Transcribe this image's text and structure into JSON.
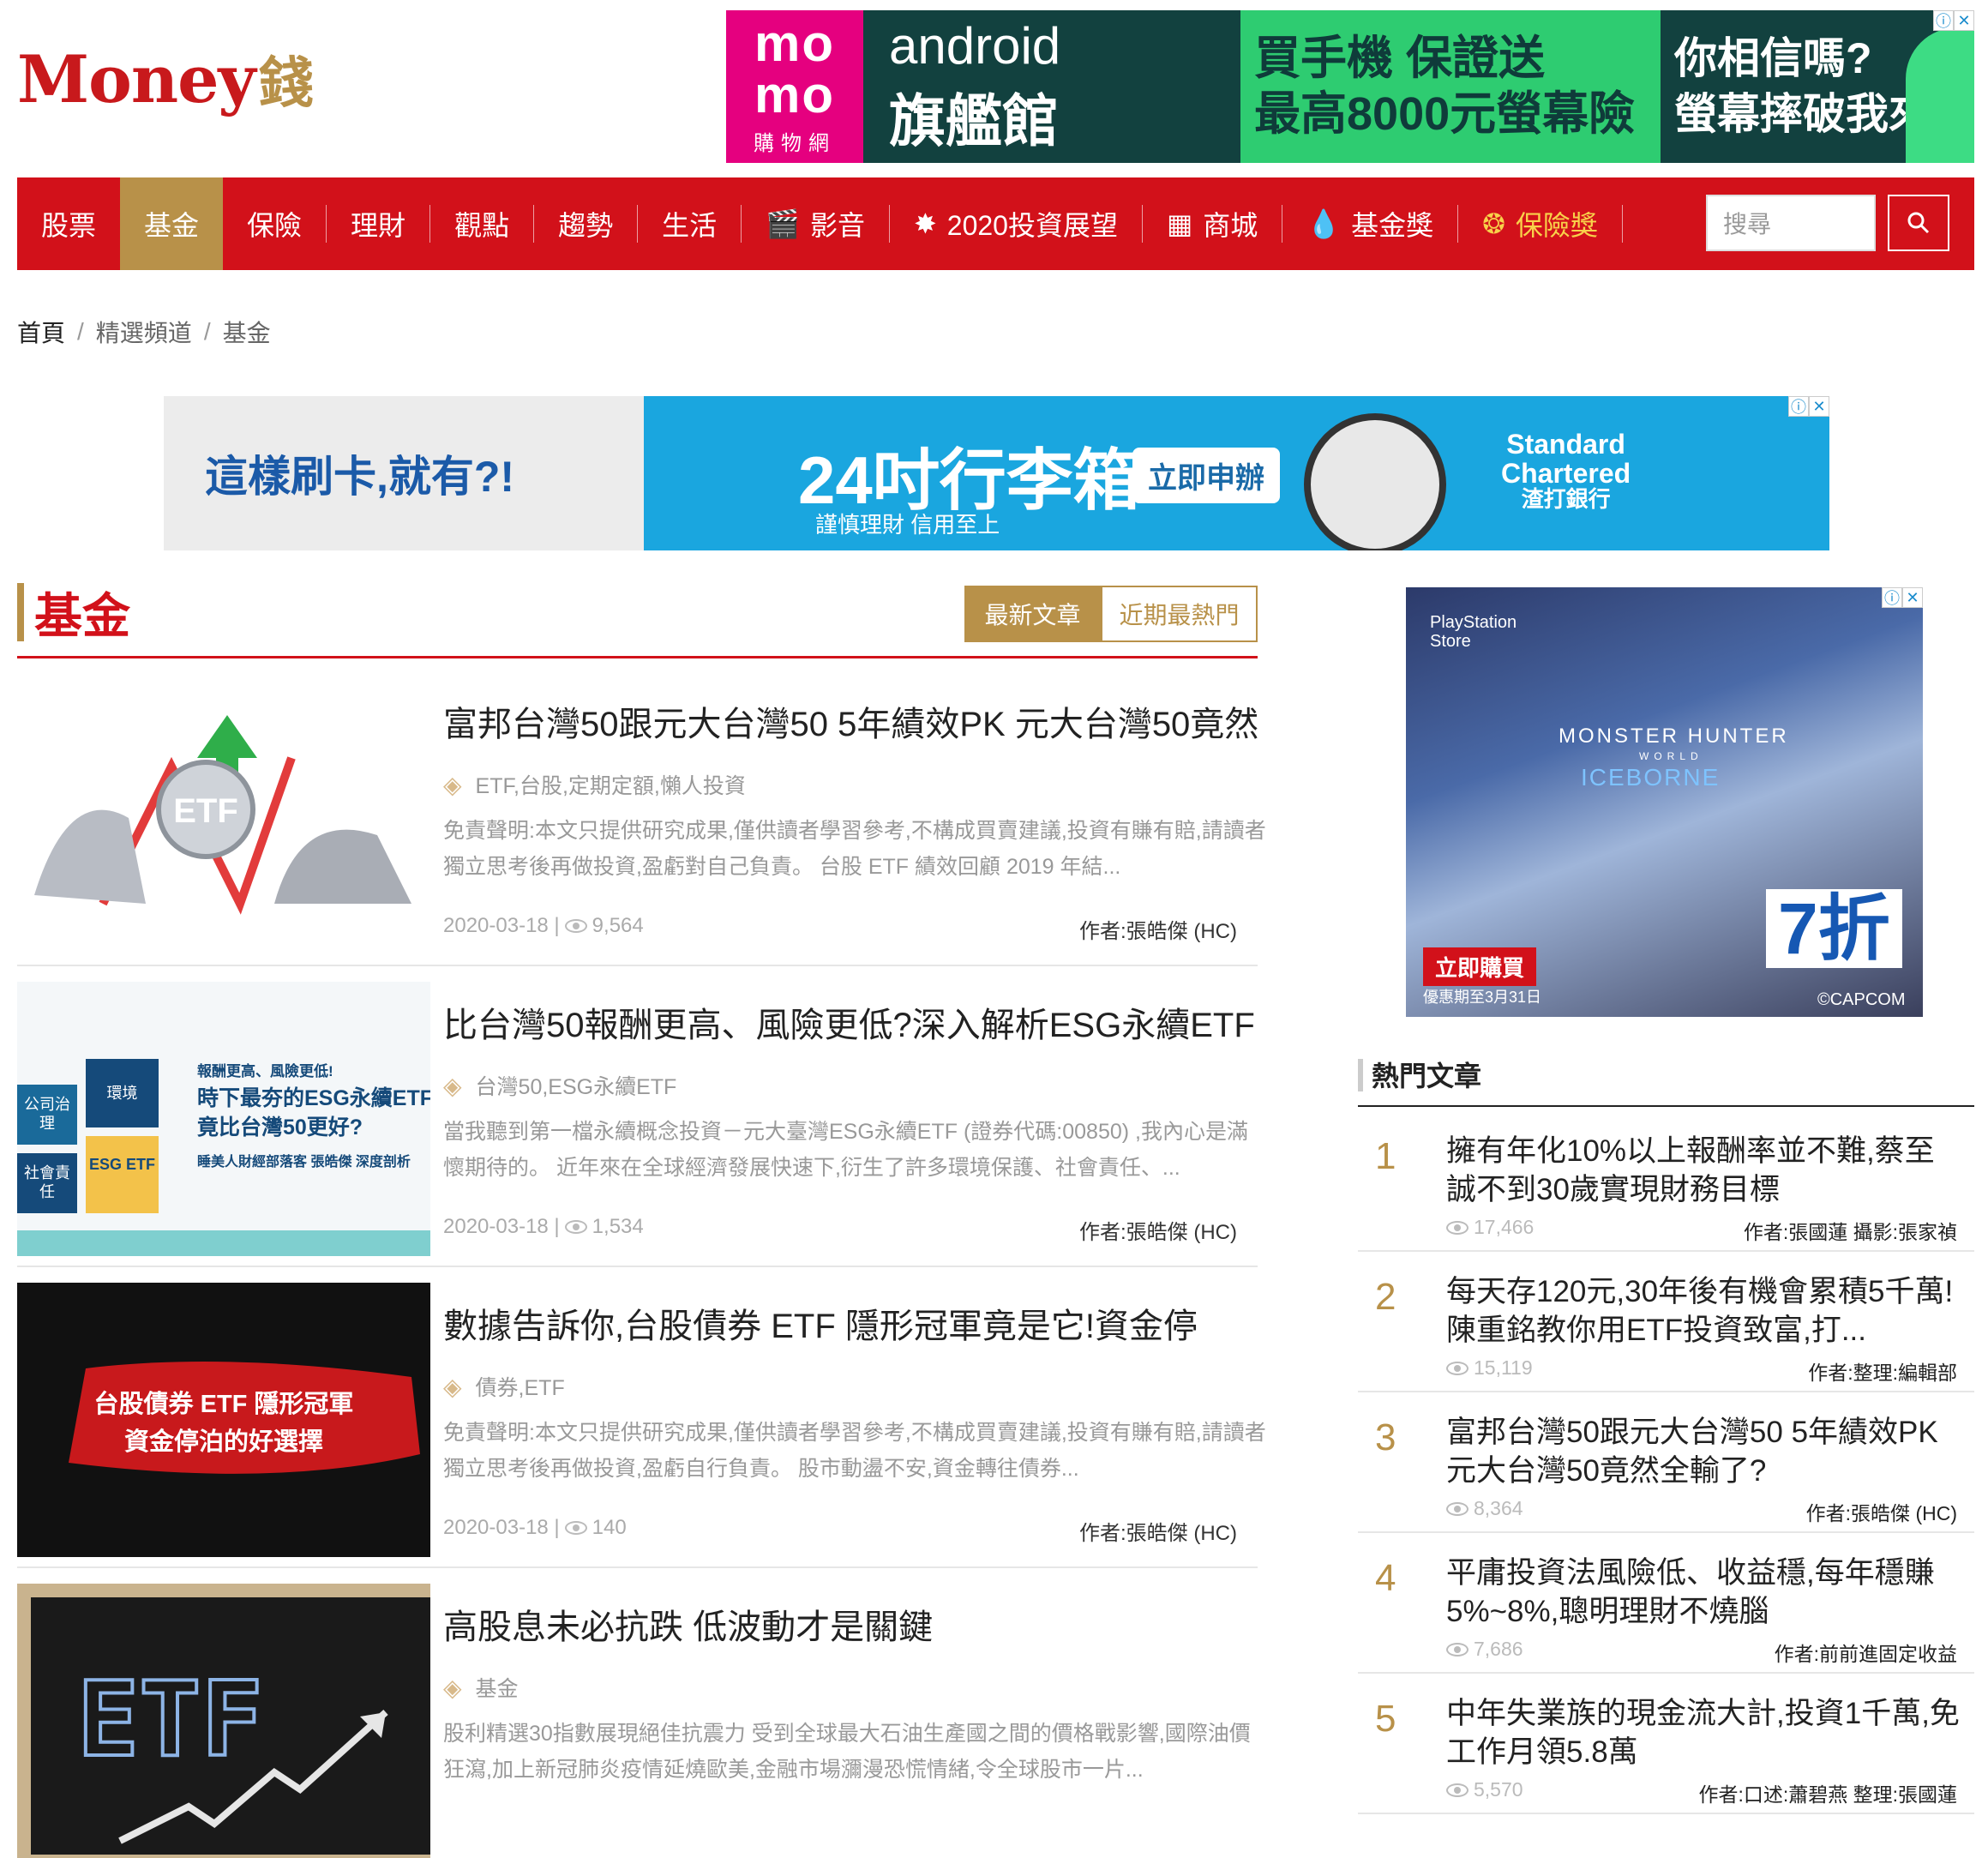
{
  "logo": {
    "main": "Money",
    "sub": "錢"
  },
  "top_ad": {
    "momo_big": "mo\nmo",
    "momo_small": "購物網",
    "line1": "android",
    "line2": "旗艦館",
    "green1": "買手機 保證送",
    "green2": "最高8000元螢幕險",
    "right1": "你相信嗎?",
    "right2": "螢幕摔破我來賠"
  },
  "nav": {
    "items": [
      {
        "label": "股票"
      },
      {
        "label": "基金"
      },
      {
        "label": "保險"
      },
      {
        "label": "理財"
      },
      {
        "label": "觀點"
      },
      {
        "label": "趨勢"
      },
      {
        "label": "生活"
      },
      {
        "label": "影音"
      },
      {
        "label": "2020投資展望"
      },
      {
        "label": "商城"
      },
      {
        "label": "基金獎"
      },
      {
        "label": "保險獎"
      }
    ],
    "search_placeholder": "搜尋"
  },
  "breadcrumb": [
    "首頁",
    "精選頻道",
    "基金"
  ],
  "mid_ad": {
    "left": "這樣刷卡,就有?!",
    "headline": "24吋行李箱",
    "button": "立即申辦",
    "sub": "謹慎理財 信用至上",
    "brand_en": "Standard\nChartered",
    "brand_cn": "渣打銀行"
  },
  "section": {
    "title": "基金",
    "tab_latest": "最新文章",
    "tab_hot": "近期最熱門"
  },
  "articles": [
    {
      "title": "富邦台灣50跟元大台灣50 5年績效PK 元大台灣50竟然",
      "tags": "ETF,台股,定期定額,懶人投資",
      "excerpt": "免責聲明:本文只提供研究成果,僅供讀者學習參考,不構成買賣建議,投資有賺有賠,請讀者獨立思考後再做投資,盈虧對自己負責。 台股 ETF 績效回顧 2019 年結...",
      "date": "2020-03-18 |",
      "views": "9,564",
      "author": "作者:張皓傑 (HC)",
      "thumb_text": "ETF"
    },
    {
      "title": "比台灣50報酬更高、風險更低?深入解析ESG永續ETF",
      "tags": "台灣50,ESG永續ETF",
      "excerpt": "當我聽到第一檔永續概念投資－元大臺灣ESG永續ETF (證券代碼:00850) ,我內心是滿懷期待的。 近年來在全球經濟發展快速下,衍生了許多環境保護、社會責任、...",
      "date": "2020-03-18 |",
      "views": "1,534",
      "author": "作者:張皓傑 (HC)",
      "thumb_l1": "報酬更高、風險更低!",
      "thumb_l2": "時下最夯的ESG永續ETF",
      "thumb_l3": "竟比台灣50更好?",
      "thumb_l4": "睡美人財經部落客 張皓傑 深度剖析",
      "puzzle": [
        "公司治理",
        "環境",
        "社會責任",
        "ESG ETF"
      ]
    },
    {
      "title": "數據告訴你,台股債券 ETF 隱形冠軍竟是它!資金停",
      "tags": "債券,ETF",
      "excerpt": "免責聲明:本文只提供研究成果,僅供讀者學習參考,不構成買賣建議,投資有賺有賠,請讀者獨立思考後再做投資,盈虧自行負責。 股市動盪不安,資金轉往債券...",
      "date": "2020-03-18 |",
      "views": "140",
      "author": "作者:張皓傑 (HC)",
      "thumb_l1": "台股債券 ETF 隱形冠軍",
      "thumb_l2": "資金停泊的好選擇"
    },
    {
      "title": "高股息未必抗跌 低波動才是關鍵",
      "tags": "基金",
      "excerpt": "股利精選30指數展現絕佳抗震力 受到全球最大石油生產國之間的價格戰影響,國際油價狂瀉,加上新冠肺炎疫情延燒歐美,金融市場瀰漫恐慌情緒,令全球股市一片...",
      "thumb_text": "ETF"
    }
  ],
  "side_ad": {
    "ps": "PlayStation\nStore",
    "mh": "MONSTER HUNTER",
    "world": "WORLD",
    "ib": "ICEBORNE",
    "buy": "立即購買",
    "deal": "優惠期至3月31日",
    "off": "7折",
    "cap": "©CAPCOM"
  },
  "hot": {
    "title": "熱門文章",
    "items": [
      {
        "num": "1",
        "title": "擁有年化10%以上報酬率並不難,蔡至誠不到30歲實現財務目標",
        "views": "17,466",
        "author": "作者:張國蓮 攝影:張家禎"
      },
      {
        "num": "2",
        "title": "每天存120元,30年後有機會累積5千萬!陳重銘教你用ETF投資致富,打...",
        "views": "15,119",
        "author": "作者:整理:編輯部"
      },
      {
        "num": "3",
        "title": "富邦台灣50跟元大台灣50 5年績效PK 元大台灣50竟然全輸了?",
        "views": "8,364",
        "author": "作者:張皓傑 (HC)"
      },
      {
        "num": "4",
        "title": "平庸投資法風險低、收益穩,每年穩賺5%~8%,聰明理財不燒腦",
        "views": "7,686",
        "author": "作者:前前進固定收益"
      },
      {
        "num": "5",
        "title": "中年失業族的現金流大計,投資1千萬,免工作月領5.8萬",
        "views": "5,570",
        "author": "作者:口述:蕭碧燕 整理:張國蓮"
      }
    ]
  },
  "colors": {
    "brand_red": "#d2111a",
    "gold": "#b89149"
  },
  "icons": [
    "clapper-icon",
    "star-icon",
    "store-icon",
    "drop-icon",
    "swirl-icon",
    "search-icon",
    "tag-icon",
    "eye-icon",
    "ad-info-icon",
    "ad-close-icon"
  ]
}
